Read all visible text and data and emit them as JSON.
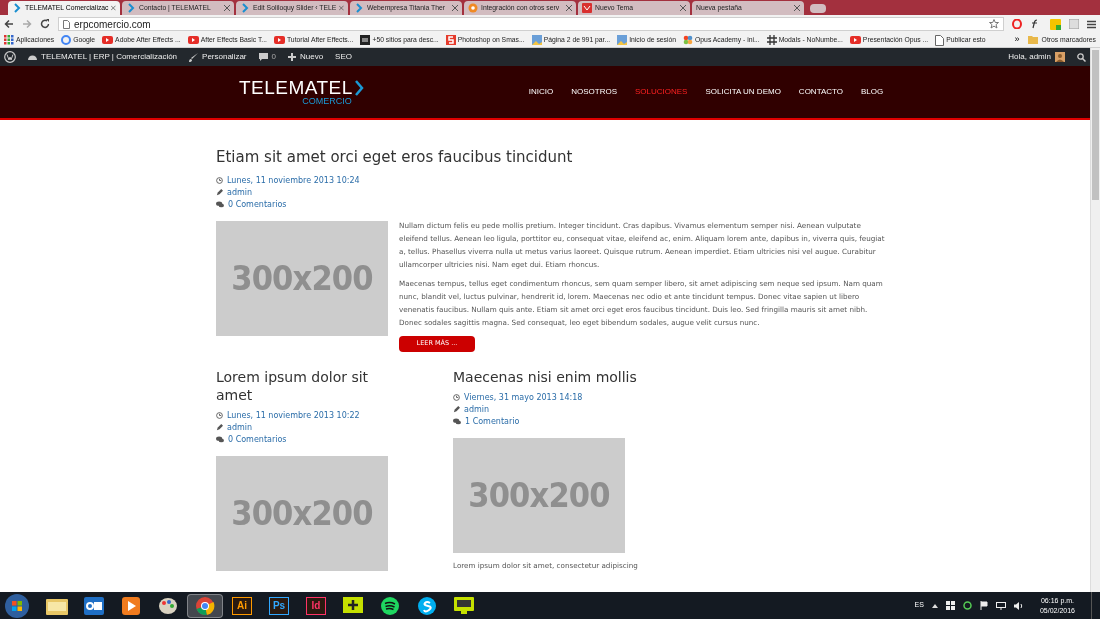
{
  "browser": {
    "tabs": [
      {
        "title": "TELEMATEL Comercializac",
        "selected": true,
        "kind": "chevron"
      },
      {
        "title": "Contacto | TELEMATEL",
        "selected": false,
        "kind": "chevron"
      },
      {
        "title": "Edit Soliloquy Slider ‹ TELE",
        "selected": false,
        "kind": "chevron"
      },
      {
        "title": "Webempresa Titania Ther",
        "selected": false,
        "kind": "chevron"
      },
      {
        "title": "Integración con otros serv",
        "selected": false,
        "kind": "gear"
      },
      {
        "title": "Nuevo Tema",
        "selected": false,
        "kind": "mail"
      },
      {
        "title": "Nueva pestaña",
        "selected": false,
        "kind": "none"
      }
    ],
    "address": "erpcomercio.com",
    "bookmarks": [
      {
        "label": "Aplicaciones",
        "kind": "apps"
      },
      {
        "label": "Google",
        "kind": "google"
      },
      {
        "label": "Adobe After Effects ...",
        "kind": "youtube"
      },
      {
        "label": "After Effects Basic T...",
        "kind": "youtube"
      },
      {
        "label": "Tutorial After Effects...",
        "kind": "youtube"
      },
      {
        "label": "+50 sitios para desc...",
        "kind": "dark"
      },
      {
        "label": "Photoshop on Smas...",
        "kind": "smash"
      },
      {
        "label": "Página 2 de 991 par...",
        "kind": "photo"
      },
      {
        "label": "Inicio de sesión",
        "kind": "photo"
      },
      {
        "label": "Opus Academy - ini...",
        "kind": "joomla"
      },
      {
        "label": "Modals - NoNumbe...",
        "kind": "hash"
      },
      {
        "label": "Presentación Opus ...",
        "kind": "youtube"
      },
      {
        "label": "Publicar esto",
        "kind": "page"
      }
    ],
    "more": "»",
    "other_bookmarks": "Otros marcadores"
  },
  "admin_bar": {
    "site": "TELEMATEL | ERP | Comercialización",
    "customize": "Personalizar",
    "comments": "0",
    "new": "Nuevo",
    "seo": "SEO",
    "greeting": "Hola, admin"
  },
  "header": {
    "logo": "TELEMATEL",
    "logo_sub": "COMERCIO",
    "nav": [
      {
        "label": "INICIO",
        "selected": false
      },
      {
        "label": "NOSOTROS",
        "selected": false
      },
      {
        "label": "SOLUCIONES",
        "selected": true
      },
      {
        "label": "SOLICITA UN DEMO",
        "selected": false
      },
      {
        "label": "CONTACTO",
        "selected": false
      },
      {
        "label": "BLOG",
        "selected": false
      }
    ]
  },
  "featured": {
    "title": "Etiam sit amet orci eget eros faucibus tincidunt",
    "date": "Lunes, 11 noviembre 2013 10:24",
    "author": "admin",
    "comments": "0 Comentarios",
    "image_label": "300x200",
    "paragraphs": [
      "Nullam dictum felis eu pede mollis pretium. Integer tincidunt. Cras dapibus. Vivamus elementum semper nisi. Aenean vulputate eleifend tellus. Aenean leo ligula, porttitor eu, consequat vitae, eleifend ac, enim. Aliquam lorem ante, dapibus in, viverra quis, feugiat a, tellus. Phasellus viverra nulla ut metus varius laoreet. Quisque rutrum. Aenean imperdiet. Etiam ultricies nisi vel augue. Curabitur ullamcorper ultricies nisi. Nam eget dui. Etiam rhoncus.",
      "Maecenas tempus, tellus eget condimentum rhoncus, sem quam semper libero, sit amet adipiscing sem neque sed ipsum. Nam quam nunc, blandit vel, luctus pulvinar, hendrerit id, lorem. Maecenas nec odio et ante tincidunt tempus. Donec vitae sapien ut libero venenatis faucibus. Nullam quis ante. Etiam sit amet orci eget eros faucibus tincidunt. Duis leo. Sed fringilla mauris sit amet nibh. Donec sodales sagittis magna. Sed consequat, leo eget bibendum sodales, augue velit cursus nunc."
    ],
    "button": "LEER MÁS ..."
  },
  "posts": [
    {
      "title": "Lorem ipsum dolor sit amet",
      "date": "Lunes, 11 noviembre 2013 10:22",
      "author": "admin",
      "comments": "0 Comentarios",
      "image_label": "300x200"
    },
    {
      "title": "Maecenas nisi enim mollis",
      "date": "Viernes, 31 mayo 2013 14:18",
      "author": "admin",
      "comments": "1 Comentario",
      "image_label": "300x200",
      "excerpt": "Lorem ipsum dolor sit amet, consectetur adipiscing"
    }
  ],
  "taskbar": {
    "apps": [
      {
        "kind": "folder",
        "active": false
      },
      {
        "kind": "outlook",
        "active": false
      },
      {
        "kind": "media",
        "active": false
      },
      {
        "kind": "paint",
        "active": false
      },
      {
        "kind": "chrome",
        "active": true
      },
      {
        "kind": "letter",
        "label": "Ai",
        "color": "#ff9a00",
        "active": false
      },
      {
        "kind": "letter",
        "label": "Ps",
        "color": "#31a8ff",
        "active": false
      },
      {
        "kind": "letter",
        "label": "Id",
        "color": "#ff3366",
        "active": false
      },
      {
        "kind": "plus",
        "active": false
      },
      {
        "kind": "spotify",
        "active": false
      },
      {
        "kind": "skype",
        "active": false
      },
      {
        "kind": "monitor",
        "active": false
      }
    ],
    "language": "ES",
    "time": "06:16 p.m.",
    "date": "05/02/2016"
  }
}
